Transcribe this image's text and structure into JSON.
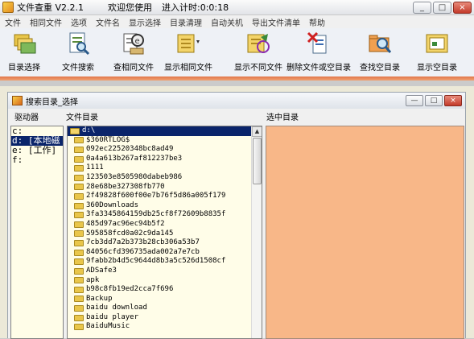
{
  "window": {
    "title": "文件查重 V2.2.1",
    "welcome": "欢迎您使用",
    "timer": "进入计时:0:0:18",
    "btn_min": "_",
    "btn_max": "□",
    "btn_close": "×"
  },
  "menu": [
    "文件",
    "相同文件",
    "选项",
    "文件名",
    "显示选择",
    "目录清理",
    "自动关机",
    "导出文件清单",
    "帮助"
  ],
  "toolbar": {
    "items": [
      {
        "label": "目录选择",
        "icon": "folders-icon"
      },
      {
        "label": "文件搜索",
        "icon": "file-search-icon"
      },
      {
        "label": "查相同文件",
        "icon": "find-duplicate-icon"
      },
      {
        "label": "显示相同文件",
        "icon": "show-duplicate-icon"
      },
      {
        "label": "显示不同文件",
        "icon": "show-different-icon"
      },
      {
        "label": "删除文件或空目录",
        "icon": "delete-file-icon"
      },
      {
        "label": "查找空目录",
        "icon": "find-empty-folder-icon"
      },
      {
        "label": "显示空目录",
        "icon": "show-empty-folder-icon"
      }
    ]
  },
  "subwindow": {
    "title": "搜索目录_选择",
    "btn_min": "—",
    "btn_max": "□",
    "btn_close": "×",
    "col_drive": "驱动器",
    "col_dir": "文件目录",
    "col_selected": "选中目录"
  },
  "drives": [
    "c:",
    "d: [本地磁",
    "e: [工作]",
    "f:"
  ],
  "directories": {
    "root": "d:\\",
    "items": [
      "$360RTLOG$",
      "092ec22520348bc8ad49",
      "0a4a613b267af812237be3",
      "1111",
      "123503e8505980dabeb986",
      "28e68be327308fb770",
      "2f49828f600f00e7b76f5d86a005f179",
      "360Downloads",
      "3fa3345864159db25cf8f72609b8835f",
      "485d97ac96ec94b5f2",
      "595858fcd0a02c9da145",
      "7cb3dd7a2b373b28cb306a53b7",
      "84056cfd396735ada002a7e7cb",
      "9fabb2b4d5c9644d8b3a5c526d1508cf",
      "ADSafe3",
      "apk",
      "b98c8fb19ed2cca7f696",
      "Backup",
      "baidu download",
      "baidu player",
      "BaiduMusic"
    ]
  },
  "colors": {
    "selected_pane": "#f8b788",
    "list_bg": "#fffde8",
    "selection": "#0a246a"
  }
}
